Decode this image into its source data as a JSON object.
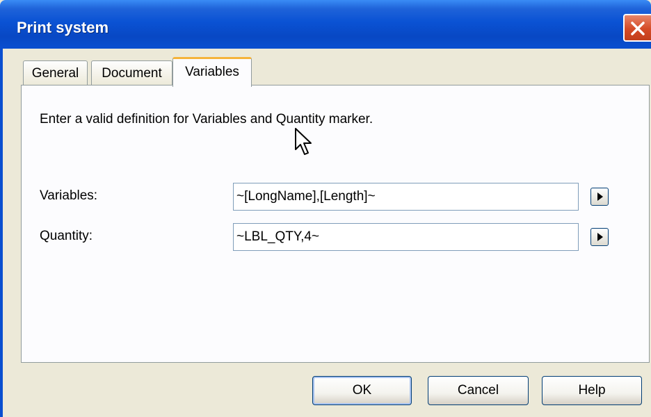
{
  "window": {
    "title": "Print system",
    "close_icon": "close-icon",
    "colors": {
      "titlebar": "#0a52d4",
      "close_button": "#d54a26",
      "dialog_bg": "#ece9d8",
      "panel_bg": "#fcfcfe",
      "active_tab_accent": "#f5b33a"
    }
  },
  "tabs": [
    {
      "label": "General",
      "active": false
    },
    {
      "label": "Document",
      "active": false
    },
    {
      "label": "Variables",
      "active": true
    }
  ],
  "panel": {
    "instruction": "Enter a valid definition for Variables and Quantity marker.",
    "variables": {
      "label": "Variables:",
      "value": "~[LongName],[Length]~",
      "button_icon": "arrow-right-icon"
    },
    "quantity": {
      "label": "Quantity:",
      "value": "~LBL_QTY,4~",
      "button_icon": "arrow-right-icon"
    }
  },
  "buttons": {
    "ok": "OK",
    "cancel": "Cancel",
    "help": "Help"
  }
}
